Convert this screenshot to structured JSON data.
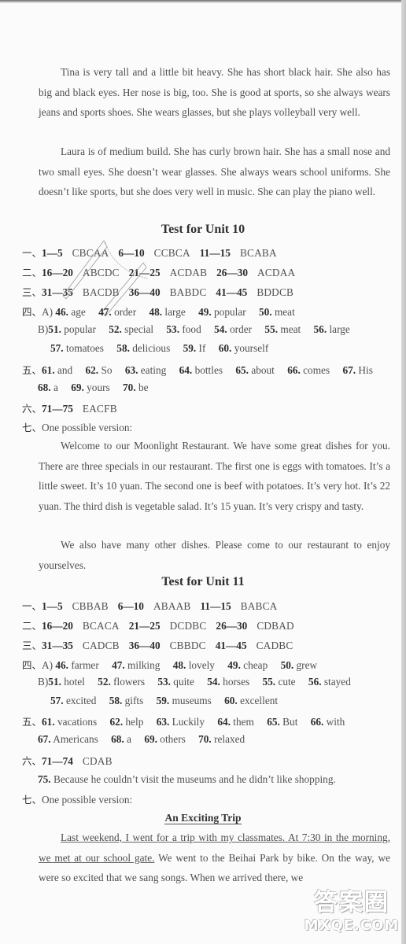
{
  "passage_top": {
    "paragraphs": [
      "Tina is very tall and a little bit heavy. She has short black hair. She also has big and black eyes. Her nose is big, too. She is good at sports, so she always wears jeans and sports shoes. She wears glasses, but she plays volleyball very well.",
      "Laura is of medium build. She has curly brown hair. She has a small nose and two small eyes. She doesn’t wear glasses. She always wears school uniforms. She doesn’t like sports, but she does very well in music. She can play the piano well."
    ]
  },
  "unit10": {
    "title": "Test for Unit 10",
    "sec1": {
      "label": "一、",
      "groups": [
        {
          "range": "1—5",
          "answers": "CBCAA"
        },
        {
          "range": "6—10",
          "answers": "CCBCA"
        },
        {
          "range": "11—15",
          "answers": "BCABA"
        }
      ]
    },
    "sec2": {
      "label": "二、",
      "groups": [
        {
          "range": "16—20",
          "answers": "ABCDC"
        },
        {
          "range": "21—25",
          "answers": "ACDAB"
        },
        {
          "range": "26—30",
          "answers": "ACDAA"
        }
      ]
    },
    "sec3": {
      "label": "三、",
      "groups": [
        {
          "range": "31—35",
          "answers": "BACDB"
        },
        {
          "range": "36—40",
          "answers": "BABDC"
        },
        {
          "range": "41—45",
          "answers": "BDDCB"
        }
      ]
    },
    "sec4": {
      "label": "四、",
      "partA": "A)",
      "partB": "B)",
      "a_items": [
        {
          "num": "46.",
          "word": "age"
        },
        {
          "num": "47.",
          "word": "order"
        },
        {
          "num": "48.",
          "word": "large"
        },
        {
          "num": "49.",
          "word": "popular"
        },
        {
          "num": "50.",
          "word": "meat"
        }
      ],
      "b_items": [
        {
          "num": "51.",
          "word": "popular"
        },
        {
          "num": "52.",
          "word": "special"
        },
        {
          "num": "53.",
          "word": "food"
        },
        {
          "num": "54.",
          "word": "order"
        },
        {
          "num": "55.",
          "word": "meat"
        },
        {
          "num": "56.",
          "word": "large"
        },
        {
          "num": "57.",
          "word": "tomatoes"
        },
        {
          "num": "58.",
          "word": "delicious"
        },
        {
          "num": "59.",
          "word": "If"
        },
        {
          "num": "60.",
          "word": "yourself"
        }
      ]
    },
    "sec5": {
      "label": "五、",
      "items": [
        {
          "num": "61.",
          "word": "and"
        },
        {
          "num": "62.",
          "word": "So"
        },
        {
          "num": "63.",
          "word": "eating"
        },
        {
          "num": "64.",
          "word": "bottles"
        },
        {
          "num": "65.",
          "word": "about"
        },
        {
          "num": "66.",
          "word": "comes"
        },
        {
          "num": "67.",
          "word": "His"
        },
        {
          "num": "68.",
          "word": "a"
        },
        {
          "num": "69.",
          "word": "yours"
        },
        {
          "num": "70.",
          "word": "be"
        }
      ]
    },
    "sec6": {
      "label": "六、",
      "range": "71—75",
      "answers": "EACFB"
    },
    "sec7": {
      "label": "七、",
      "intro": "One possible version:",
      "paragraphs": [
        "Welcome to our Moonlight Restaurant. We have some great dishes for you. There are three specials in our restaurant. The first one is eggs with tomatoes. It’s a little sweet. It’s 10 yuan. The second one is beef with potatoes. It’s very hot. It’s 22 yuan. The third dish is vegetable salad. It’s 15 yuan. It’s very crispy and tasty.",
        "We also have many other dishes. Please come to our restaurant to enjoy yourselves."
      ]
    }
  },
  "unit11": {
    "title": "Test for Unit 11",
    "sec1": {
      "label": "一、",
      "groups": [
        {
          "range": "1—5",
          "answers": "CBBAB"
        },
        {
          "range": "6—10",
          "answers": "ABAAB"
        },
        {
          "range": "11—15",
          "answers": "BABCA"
        }
      ]
    },
    "sec2": {
      "label": "二、",
      "groups": [
        {
          "range": "16—20",
          "answers": "BCACA"
        },
        {
          "range": "21—25",
          "answers": "DCDBC"
        },
        {
          "range": "26—30",
          "answers": "CDBAD"
        }
      ]
    },
    "sec3": {
      "label": "三、",
      "groups": [
        {
          "range": "31—35",
          "answers": "CADCB"
        },
        {
          "range": "36—40",
          "answers": "CBBDC"
        },
        {
          "range": "41—45",
          "answers": "CADBC"
        }
      ]
    },
    "sec4": {
      "label": "四、",
      "partA": "A)",
      "partB": "B)",
      "a_items": [
        {
          "num": "46.",
          "word": "farmer"
        },
        {
          "num": "47.",
          "word": "milking"
        },
        {
          "num": "48.",
          "word": "lovely"
        },
        {
          "num": "49.",
          "word": "cheap"
        },
        {
          "num": "50.",
          "word": "grew"
        }
      ],
      "b_items": [
        {
          "num": "51.",
          "word": "hotel"
        },
        {
          "num": "52.",
          "word": "flowers"
        },
        {
          "num": "53.",
          "word": "quite"
        },
        {
          "num": "54.",
          "word": "horses"
        },
        {
          "num": "55.",
          "word": "cute"
        },
        {
          "num": "56.",
          "word": "stayed"
        },
        {
          "num": "57.",
          "word": "excited"
        },
        {
          "num": "58.",
          "word": "gifts"
        },
        {
          "num": "59.",
          "word": "museums"
        },
        {
          "num": "60.",
          "word": "excellent"
        }
      ]
    },
    "sec5": {
      "label": "五、",
      "items": [
        {
          "num": "61.",
          "word": "vacations"
        },
        {
          "num": "62.",
          "word": "help"
        },
        {
          "num": "63.",
          "word": "Luckily"
        },
        {
          "num": "64.",
          "word": "them"
        },
        {
          "num": "65.",
          "word": "But"
        },
        {
          "num": "66.",
          "word": "with"
        },
        {
          "num": "67.",
          "word": "Americans"
        },
        {
          "num": "68.",
          "word": "a"
        },
        {
          "num": "69.",
          "word": "others"
        },
        {
          "num": "70.",
          "word": "relaxed"
        }
      ]
    },
    "sec6": {
      "label": "六、",
      "range": "71—74",
      "answers": "CDAB",
      "q75_num": "75.",
      "q75_text": "Because he couldn’t visit the museums and he didn’t like shopping."
    },
    "sec7": {
      "label": "七、",
      "intro": "One possible version:",
      "essay_title": "An Exciting Trip",
      "underlined_text": "Last weekend, I went for a trip with my classmates. At 7:30 in the morning, we met at our school gate.",
      "rest_text": " We went to the Beihai Park by bike. On the way, we were so excited that we sang songs. When we arrived there, we"
    }
  },
  "watermark": {
    "cn": "答案圈",
    "en": "MXQE.COM"
  }
}
